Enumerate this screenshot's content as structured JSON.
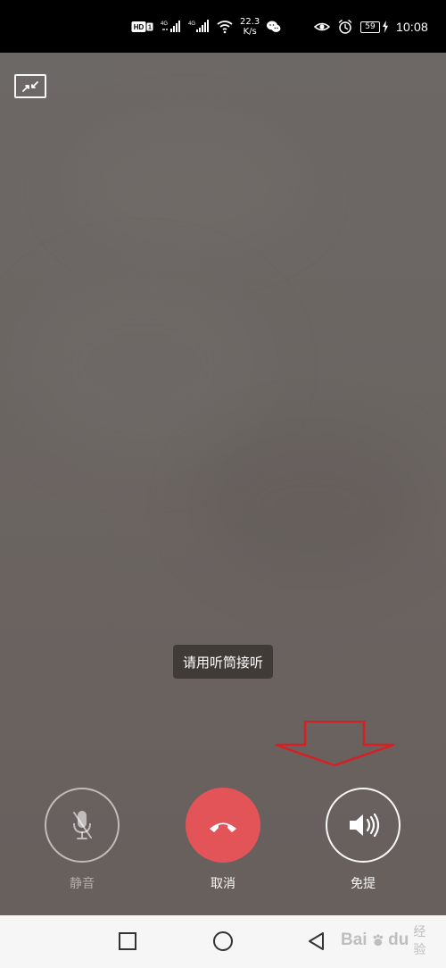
{
  "status_bar": {
    "badge_hd": "HD",
    "badge_one": "1",
    "network_one": "4G",
    "network_two": "4G",
    "speed_value": "22.3",
    "speed_unit": "K/s",
    "battery_level": "59",
    "time": "10:08",
    "icons": {
      "wifi": "wifi-icon",
      "wechat": "wechat-icon",
      "eye": "eye-icon",
      "alarm": "alarm-icon",
      "charging": "charging-icon"
    }
  },
  "call_screen": {
    "minimize_icon": "minimize-icon",
    "toast_text": "请用听筒接听",
    "controls": {
      "mute_label": "静音",
      "cancel_label": "取消",
      "speaker_label": "免提"
    },
    "icons": {
      "mute": "microphone-mute-icon",
      "cancel": "hangup-icon",
      "speaker": "speaker-icon",
      "annotation": "down-arrow-icon"
    },
    "colors": {
      "background": "#6b6461",
      "cancel_button": "#e25458",
      "annotation_arrow": "#d71f24"
    }
  },
  "navigation_bar": {
    "icons": {
      "square": "recent-apps-icon",
      "circle": "home-icon",
      "back": "back-icon"
    }
  },
  "watermark": {
    "brand": "Bai",
    "logo": "paw-icon",
    "brand_suffix": "du",
    "sub_text": "经验"
  }
}
